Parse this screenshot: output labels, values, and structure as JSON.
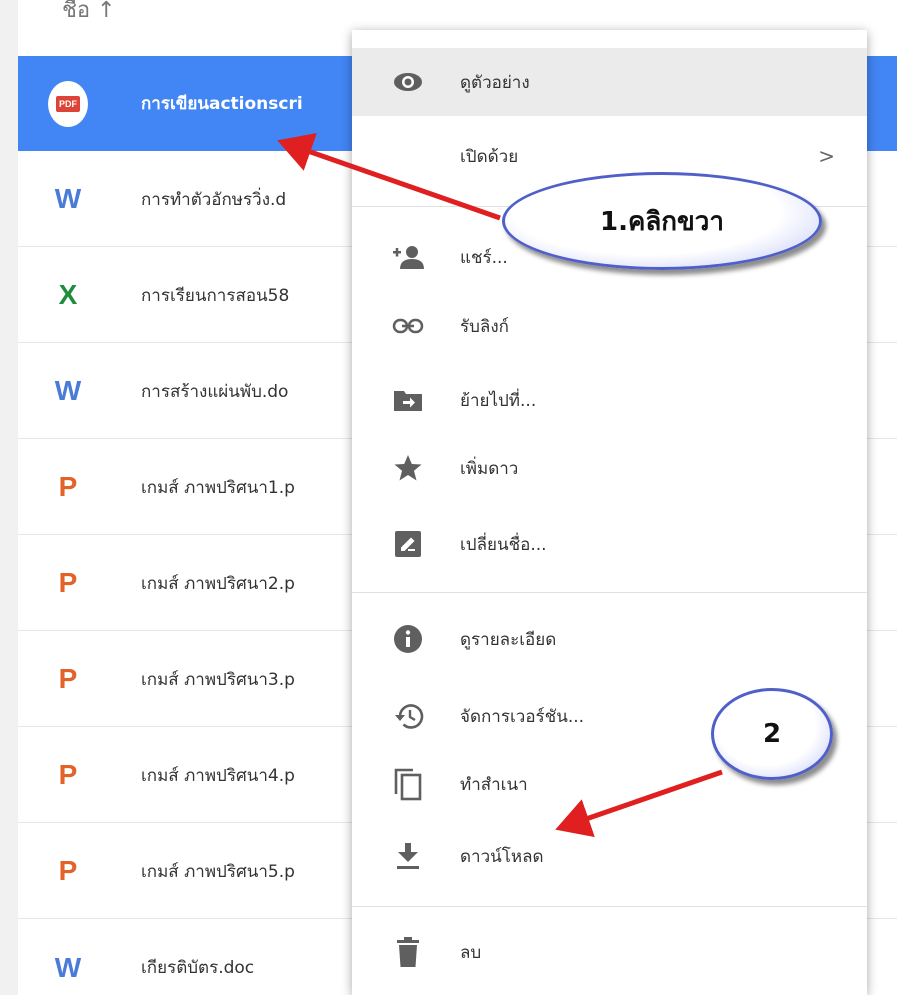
{
  "header": {
    "text": "ชื่อ ↑"
  },
  "files": [
    {
      "name": "การเขียนactionscri",
      "type": "pdf",
      "icon": "PDF",
      "selected": true
    },
    {
      "name": "การทำตัวอักษรวิ่ง.d",
      "type": "word",
      "icon": "W"
    },
    {
      "name": "การเรียนการสอน58",
      "type": "excel",
      "icon": "X"
    },
    {
      "name": "การสร้างแผ่นพับ.do",
      "type": "word",
      "icon": "W"
    },
    {
      "name": "เกมส์ ภาพปริศนา1.p",
      "type": "ppt",
      "icon": "P"
    },
    {
      "name": "เกมส์ ภาพปริศนา2.p",
      "type": "ppt",
      "icon": "P"
    },
    {
      "name": "เกมส์ ภาพปริศนา3.p",
      "type": "ppt",
      "icon": "P"
    },
    {
      "name": "เกมส์ ภาพปริศนา4.p",
      "type": "ppt",
      "icon": "P"
    },
    {
      "name": "เกมส์ ภาพปริศนา5.p",
      "type": "ppt",
      "icon": "P"
    },
    {
      "name": "เกียรติบัตร.doc",
      "type": "word",
      "icon": "W"
    }
  ],
  "context_menu": {
    "items": [
      {
        "label": "ดูตัวอย่าง",
        "icon": "eye-icon"
      },
      {
        "label": "เปิดด้วย",
        "icon": "",
        "submenu_icon": ">"
      },
      {
        "label": "แชร์...",
        "icon": "add-person-icon"
      },
      {
        "label": "รับลิงก์",
        "icon": "link-icon"
      },
      {
        "label": "ย้ายไปที่...",
        "icon": "move-to-folder-icon"
      },
      {
        "label": "เพิ่มดาว",
        "icon": "star-icon"
      },
      {
        "label": "เปลี่ยนชื่อ...",
        "icon": "rename-icon"
      },
      {
        "label": "ดูรายละเอียด",
        "icon": "info-icon"
      },
      {
        "label": "จัดการเวอร์ชัน...",
        "icon": "history-icon"
      },
      {
        "label": "ทำสำเนา",
        "icon": "copy-icon"
      },
      {
        "label": "ดาวน์โหลด",
        "icon": "download-icon"
      },
      {
        "label": "ลบ",
        "icon": "trash-icon"
      }
    ]
  },
  "annotations": {
    "step1": "1.คลิกขวา",
    "step2": "2"
  },
  "colors": {
    "selected_row": "#4285f4",
    "arrow": "#e02020",
    "pdf": "#db4437",
    "word": "#4a7bd6",
    "excel": "#1e8e3e",
    "ppt": "#e3622a"
  }
}
